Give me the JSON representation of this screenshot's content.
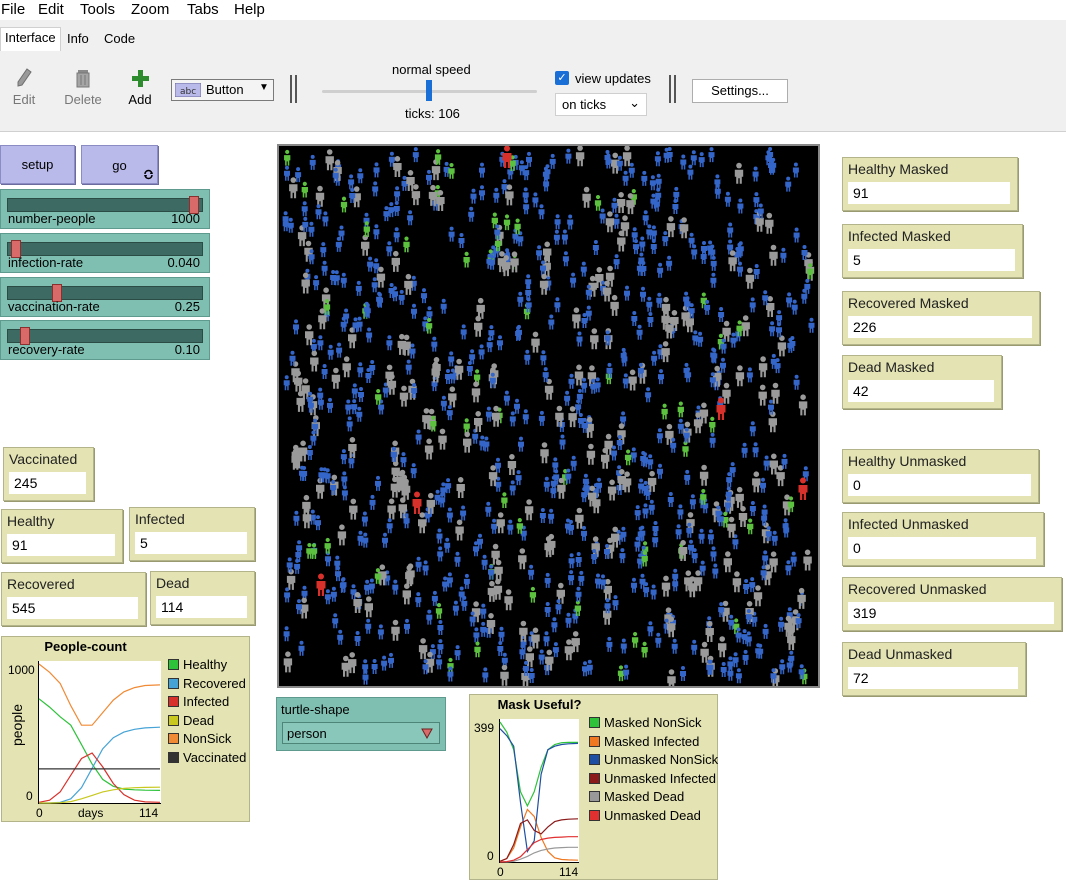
{
  "menu": [
    "File",
    "Edit",
    "Tools",
    "Zoom",
    "Tabs",
    "Help"
  ],
  "tabs": [
    {
      "label": "Interface",
      "active": true
    },
    {
      "label": "Info",
      "active": false
    },
    {
      "label": "Code",
      "active": false
    }
  ],
  "toolbar": {
    "edit_label": "Edit",
    "delete_label": "Delete",
    "add_label": "Add",
    "widget_type": "Button",
    "speed_label": "normal speed",
    "ticks_label": "ticks: 106",
    "view_updates_label": "view updates",
    "view_updates_checked": true,
    "update_mode": "on ticks",
    "settings_label": "Settings..."
  },
  "buttons": {
    "setup": "setup",
    "go": "go"
  },
  "sliders": [
    {
      "name": "number-people",
      "value": "1000",
      "fraction": 0.97
    },
    {
      "name": "infection-rate",
      "value": "0.040",
      "fraction": 0.02
    },
    {
      "name": "vaccination-rate",
      "value": "0.25",
      "fraction": 0.24
    },
    {
      "name": "recovery-rate",
      "value": "0.10",
      "fraction": 0.07
    }
  ],
  "monitors_left": {
    "vaccinated": {
      "label": "Vaccinated",
      "value": "245"
    },
    "healthy": {
      "label": "Healthy",
      "value": "91"
    },
    "infected": {
      "label": "Infected",
      "value": "5"
    },
    "recovered": {
      "label": "Recovered",
      "value": "545"
    },
    "dead": {
      "label": "Dead",
      "value": "114"
    }
  },
  "monitors_right": [
    {
      "label": "Healthy Masked",
      "value": "91"
    },
    {
      "label": "Infected Masked",
      "value": "5"
    },
    {
      "label": "Recovered Masked",
      "value": "226"
    },
    {
      "label": "Dead Masked",
      "value": "42"
    },
    {
      "label": "Healthy Unmasked",
      "value": "0"
    },
    {
      "label": "Infected Unmasked",
      "value": "0"
    },
    {
      "label": "Recovered Unmasked",
      "value": "319"
    },
    {
      "label": "Dead Unmasked",
      "value": "72"
    }
  ],
  "chooser": {
    "label": "turtle-shape",
    "value": "person"
  },
  "world": {
    "background": "#000000",
    "agent_colors": {
      "healthy": "#3465c8",
      "recovered": "#9a9a9a",
      "vaccinated": "#5cc13e",
      "infected": "#d8302a"
    }
  },
  "plots": {
    "people_count": {
      "title": "People-count",
      "ylabel": "people",
      "xlabel": "days",
      "xmin_label": "0",
      "xmax_label": "114",
      "ymin_label": "0",
      "ymax_label": "1000",
      "legend": [
        {
          "name": "Healthy",
          "color": "#2dc23a"
        },
        {
          "name": "Recovered",
          "color": "#45a3d6"
        },
        {
          "name": "Infected",
          "color": "#d8302a"
        },
        {
          "name": "Dead",
          "color": "#c8c81e"
        },
        {
          "name": "NonSick",
          "color": "#f08a35"
        },
        {
          "name": "Vaccinated",
          "color": "#333333"
        }
      ]
    },
    "mask_useful": {
      "title": "Mask Useful?",
      "xmin_label": "0",
      "xmax_label": "114",
      "ymin_label": "0",
      "ymax_label": "399",
      "legend": [
        {
          "name": "Masked NonSick",
          "color": "#2dc23a"
        },
        {
          "name": "Masked Infected",
          "color": "#f07820"
        },
        {
          "name": "Unmasked NonSick",
          "color": "#1f4fa3"
        },
        {
          "name": "Unmasked Infected",
          "color": "#8b1a1a"
        },
        {
          "name": "Masked Dead",
          "color": "#999999"
        },
        {
          "name": "Unmasked Dead",
          "color": "#e03030"
        }
      ]
    }
  },
  "chart_data": [
    {
      "type": "line",
      "title": "People-count",
      "xlabel": "days",
      "ylabel": "people",
      "xlim": [
        0,
        114
      ],
      "ylim": [
        0,
        1000
      ],
      "x": [
        0,
        10,
        20,
        30,
        40,
        50,
        60,
        70,
        80,
        90,
        100,
        114
      ],
      "series": [
        {
          "name": "Healthy",
          "values": [
            750,
            690,
            620,
            560,
            420,
            280,
            170,
            120,
            100,
            95,
            92,
            91
          ]
        },
        {
          "name": "Recovered",
          "values": [
            0,
            0,
            5,
            30,
            110,
            250,
            390,
            470,
            510,
            530,
            540,
            545
          ]
        },
        {
          "name": "Infected",
          "values": [
            5,
            20,
            80,
            200,
            320,
            360,
            260,
            140,
            60,
            20,
            8,
            5
          ]
        },
        {
          "name": "Dead",
          "values": [
            0,
            0,
            2,
            10,
            30,
            55,
            80,
            95,
            105,
            110,
            112,
            114
          ]
        },
        {
          "name": "NonSick",
          "values": [
            1000,
            940,
            860,
            700,
            560,
            560,
            650,
            740,
            800,
            830,
            845,
            850
          ]
        },
        {
          "name": "Vaccinated",
          "values": [
            245,
            245,
            245,
            245,
            245,
            245,
            245,
            245,
            245,
            245,
            245,
            245
          ]
        }
      ]
    },
    {
      "type": "line",
      "title": "Mask Useful?",
      "xlim": [
        0,
        114
      ],
      "ylim": [
        0,
        399
      ],
      "x": [
        0,
        10,
        20,
        30,
        40,
        50,
        60,
        70,
        80,
        90,
        100,
        114
      ],
      "series": [
        {
          "name": "Masked NonSick",
          "values": [
            399,
            370,
            320,
            200,
            160,
            200,
            270,
            320,
            335,
            340,
            341,
            341
          ]
        },
        {
          "name": "Masked Infected",
          "values": [
            2,
            10,
            40,
            100,
            150,
            130,
            70,
            30,
            12,
            7,
            6,
            5
          ]
        },
        {
          "name": "Unmasked NonSick",
          "values": [
            380,
            360,
            330,
            170,
            30,
            60,
            250,
            320,
            330,
            335,
            337,
            338
          ]
        },
        {
          "name": "Unmasked Infected",
          "values": [
            2,
            10,
            50,
            110,
            120,
            90,
            80,
            100,
            115,
            120,
            122,
            123
          ]
        },
        {
          "name": "Masked Dead",
          "values": [
            0,
            0,
            2,
            8,
            16,
            26,
            33,
            37,
            40,
            41,
            42,
            42
          ]
        },
        {
          "name": "Unmasked Dead",
          "values": [
            0,
            1,
            5,
            15,
            35,
            55,
            64,
            68,
            70,
            71,
            72,
            72
          ]
        }
      ]
    }
  ]
}
